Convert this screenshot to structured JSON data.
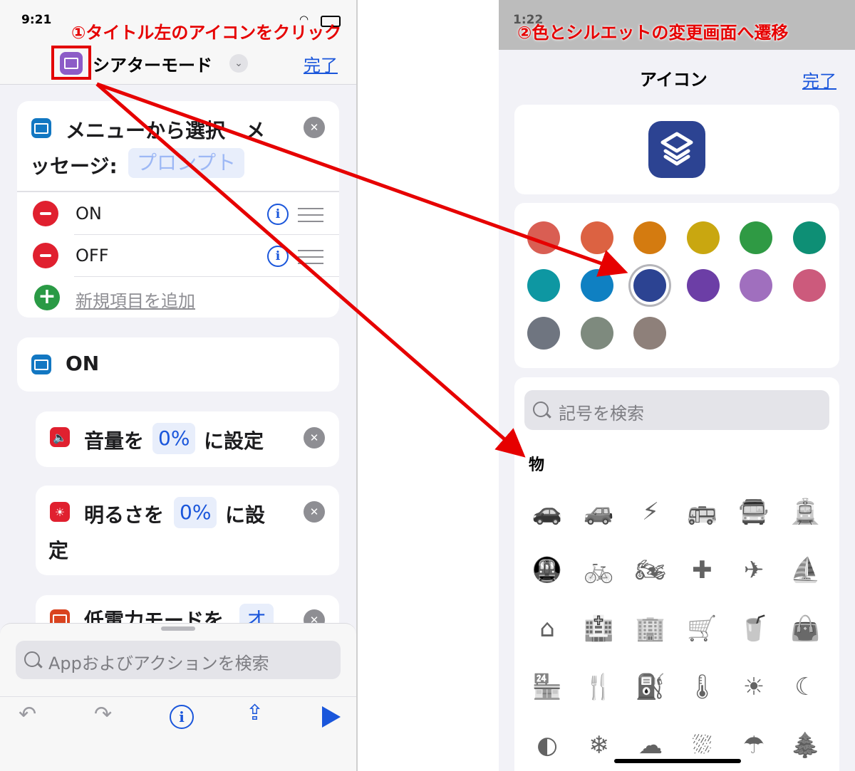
{
  "left": {
    "status": {
      "time": "9:21"
    },
    "header": {
      "title": "シアターモード",
      "done": "完了",
      "annotation": "①タイトル左のアイコンをクリック",
      "icon": "theater-mode-icon"
    },
    "menu_card": {
      "title_a": "メニューから選択　メ",
      "title_b": "ッセージ:",
      "prompt_placeholder": "プロンプト",
      "items": [
        {
          "label": "ON"
        },
        {
          "label": "OFF"
        }
      ],
      "add_label": "新規項目を追加"
    },
    "on_card": {
      "label": "ON"
    },
    "volume_card": {
      "text_a": "音量を",
      "value": "0%",
      "text_b": "に設定"
    },
    "brightness_card": {
      "text_a": "明るさを",
      "value": "0%",
      "text_b": "に設",
      "text_c": "定"
    },
    "lowpower_card": {
      "text_a": "低電力モードを",
      "value": "オ"
    },
    "search": {
      "placeholder": "Appおよびアクションを検索"
    },
    "toolbar": [
      "undo-icon",
      "redo-icon",
      "info-icon",
      "share-icon",
      "play-icon"
    ],
    "colors": {
      "accent": "#1a56db",
      "callout": "#e60000",
      "remove": "#e0202f",
      "add": "#2a9a45"
    }
  },
  "right": {
    "annotation": "②色とシルエットの変更画面へ遷移",
    "header": {
      "title": "アイコン",
      "done": "完了"
    },
    "preview_icon": "shortcuts-layers-icon",
    "preview_color": "#2c4392",
    "colors": [
      "#d95e53",
      "#dc6242",
      "#d47b10",
      "#c9a710",
      "#2f9a44",
      "#0e8f75",
      "#0e97a2",
      "#0f80c2",
      "#2c4392",
      "#6c3ea6",
      "#a06fbe",
      "#cc5a7c",
      "#6f7580",
      "#7e8a7e",
      "#8e807a"
    ],
    "selected_color_index": 8,
    "search": {
      "placeholder": "記号を検索"
    },
    "section": "物",
    "glyphs": [
      {
        "name": "car-icon",
        "char": "🚗"
      },
      {
        "name": "cars-icon",
        "char": "🚙"
      },
      {
        "name": "electric-car-icon",
        "char": "⚡"
      },
      {
        "name": "bus-icon",
        "char": "🚌"
      },
      {
        "name": "bus-front-icon",
        "char": "🚍"
      },
      {
        "name": "tram-icon",
        "char": "🚊"
      },
      {
        "name": "tram-tunnel-icon",
        "char": "🚇"
      },
      {
        "name": "bicycle-icon",
        "char": "🚲"
      },
      {
        "name": "motorcycle-icon",
        "char": "🏍"
      },
      {
        "name": "medical-cross-icon",
        "char": "✚"
      },
      {
        "name": "airplane-icon",
        "char": "✈"
      },
      {
        "name": "sailboat-icon",
        "char": "⛵"
      },
      {
        "name": "house-icon",
        "char": "⌂"
      },
      {
        "name": "hospital-icon",
        "char": "🏥"
      },
      {
        "name": "building-icon",
        "char": "🏢"
      },
      {
        "name": "cart-icon",
        "char": "🛒"
      },
      {
        "name": "takeout-bag-icon",
        "char": "🥤"
      },
      {
        "name": "bag-icon",
        "char": "👜"
      },
      {
        "name": "storefront-icon",
        "char": "🏪"
      },
      {
        "name": "fork-knife-icon",
        "char": "🍴"
      },
      {
        "name": "fuel-pump-icon",
        "char": "⛽"
      },
      {
        "name": "thermometer-icon",
        "char": "🌡"
      },
      {
        "name": "sun-icon",
        "char": "☀"
      },
      {
        "name": "moon-icon",
        "char": "☾"
      },
      {
        "name": "moon-circle-icon",
        "char": "◐"
      },
      {
        "name": "snowflake-icon",
        "char": "❄"
      },
      {
        "name": "cloud-icon",
        "char": "☁"
      },
      {
        "name": "cloud-rain-icon",
        "char": "⛆"
      },
      {
        "name": "umbrella-icon",
        "char": "☂"
      },
      {
        "name": "tree-icon",
        "char": "🌲"
      }
    ]
  }
}
